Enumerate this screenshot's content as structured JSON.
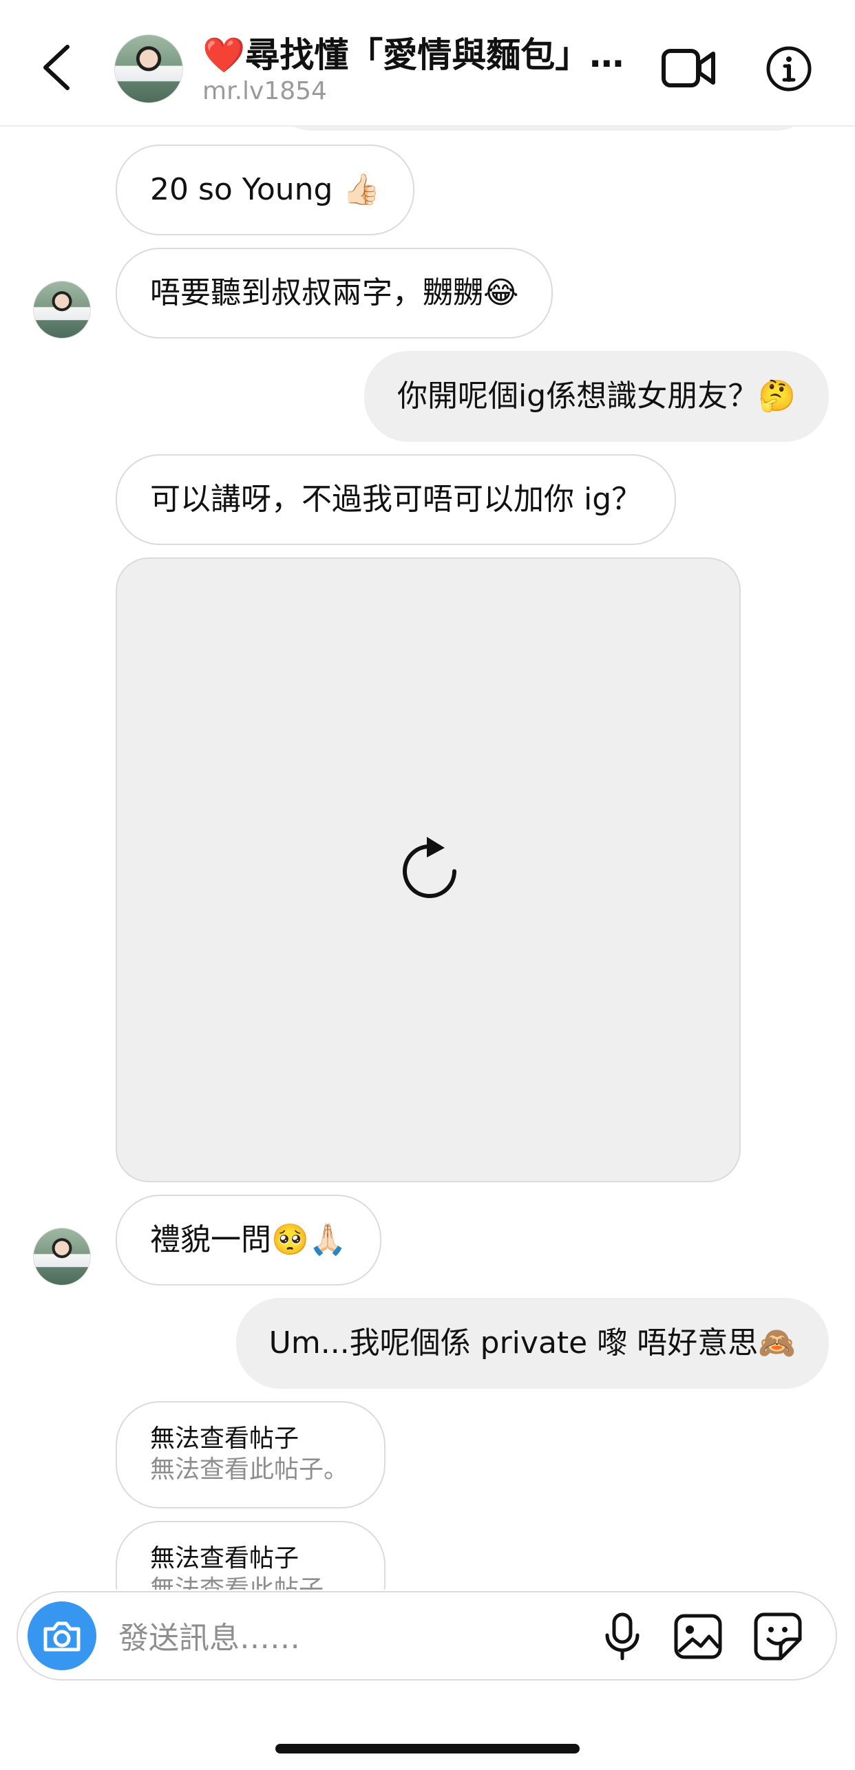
{
  "header": {
    "title": "❤️尋找懂「愛情與麵包」…",
    "username": "mr.lv1854"
  },
  "messages": [
    {
      "text": "20 so Young 👍🏻"
    },
    {
      "text": "唔要聽到叔叔兩字，嬲嬲😂"
    },
    {
      "text": "你開呢個ig係想識女朋友？🤔"
    },
    {
      "text": "可以講呀，不過我可唔可以加你 ig？"
    },
    {
      "text": "禮貌一問🥺🙏🏻"
    },
    {
      "text": "Um...我呢個係 private 嚟 唔好意思🙈"
    }
  ],
  "post_cards": [
    {
      "title": "無法查看帖子",
      "subtitle": "無法查看此帖子。"
    },
    {
      "title": "無法查看帖子",
      "subtitle": "無法查看此帖子。"
    }
  ],
  "composer": {
    "placeholder": "發送訊息……"
  },
  "colors": {
    "accent": "#3797f0",
    "incoming_border": "#dbdbdb",
    "outgoing_bg": "#efefef",
    "secondary_text": "#8e8e8e"
  },
  "icons": {
    "back": "chevron-left-icon",
    "video": "video-camera-icon",
    "info": "info-icon",
    "reload": "reload-icon",
    "camera": "camera-icon",
    "mic": "microphone-icon",
    "gallery": "image-icon",
    "sticker": "sticker-icon"
  }
}
